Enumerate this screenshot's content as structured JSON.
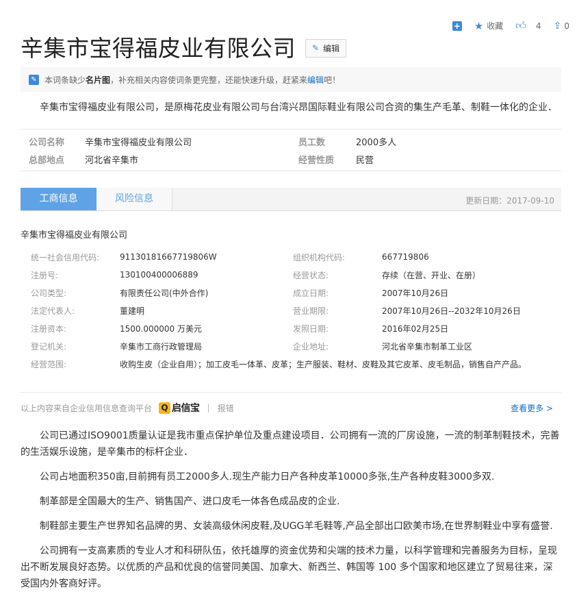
{
  "toolbar": {
    "favorite_label": "收藏",
    "like_count": "4",
    "share_count": "0"
  },
  "title": "辛集市宝得福皮业有限公司",
  "edit_label": "编辑",
  "notice": {
    "pre": "本词条缺少",
    "bold": "名片图",
    "mid": "，补充相关内容使词条更完整，还能快速升级，赶紧来",
    "link": "编辑",
    "post": "吧！"
  },
  "intro": "辛集市宝得福皮业有限公司，是原梅花皮业有限公司与台湾兴昂国际鞋业有限公司合资的集生产毛革、制鞋一体化的企业．",
  "basic_info": [
    {
      "k1": "公司名称",
      "v1": "辛集市宝得福皮业有限公司",
      "k2": "员工数",
      "v2": "2000多人"
    },
    {
      "k1": "总部地点",
      "v1": "河北省辛集市",
      "k2": "经营性质",
      "v2": "民营"
    }
  ],
  "tabs": {
    "active": "工商信息",
    "other": "风险信息",
    "update": "更新日期：2017-09-10"
  },
  "corp_name": "辛集市宝得福皮业有限公司",
  "reg_info": [
    {
      "k1": "统一社会信用代码:",
      "v1": "91130181667719806W",
      "k2": "组织机构代码:",
      "v2": "667719806"
    },
    {
      "k1": "注册号:",
      "v1": "130100400006889",
      "k2": "经营状态:",
      "v2": "存续（在营、开业、在册）"
    },
    {
      "k1": "公司类型:",
      "v1": "有限责任公司(中外合作)",
      "k2": "成立日期:",
      "v2": "2007年10月26日"
    },
    {
      "k1": "法定代表人:",
      "v1": "董建明",
      "k2": "营业期限:",
      "v2": "2007年10月26日--2032年10月26日"
    },
    {
      "k1": "注册资本:",
      "v1": "1500.000000 万美元",
      "k2": "发照日期:",
      "v2": "2016年02月25日"
    },
    {
      "k1": "登记机关:",
      "v1": "辛集市工商行政管理局",
      "k2": "企业地址:",
      "v2": "河北省辛集市制革工业区"
    }
  ],
  "scope": {
    "k": "经营范围:",
    "v": "收购生皮（企业自用）；加工皮毛一体革、皮革；生产服装、鞋材、皮鞋及其它皮革、皮毛制品，销售自产产品。"
  },
  "source": {
    "text": "以上内容来自企业信用信息查询平台",
    "logo_mark": "Q",
    "logo_text": "启信宝",
    "separator": "|",
    "report": "报错",
    "more": "查看更多 >"
  },
  "paragraphs": [
    "公司已通过ISO9001质量认证是我市重点保护单位及重点建设项目．公司拥有一流的厂房设施，一流的制革制鞋技术，完善的生活娱乐设施，是辛集市的标杆企业．",
    "公司占地面积350亩,目前拥有员工2000多人.现生产能力日产各种皮革10000多张,生产各种皮鞋3000多双.",
    "制革部是全国最大的生产、销售国产、进口皮毛一体各色成品皮的企业.",
    "制鞋部主要生产世界知名品牌的男、女装高级休闲皮鞋,及UGG羊毛鞋等,产品全部出口欧美市场,在世界制鞋业中享有盛誉.",
    "公司拥有一支高素质的专业人才和科研队伍，依托雄厚的资金优势和尖端的技术力量，以科学管理和完善服务为目标，呈现出不断发展良好态势。以优质的产品和优良的信誉同美国、加拿大、新西兰、韩国等 100 多个国家和地区建立了贸易往来，深受国内外客商好评。"
  ]
}
